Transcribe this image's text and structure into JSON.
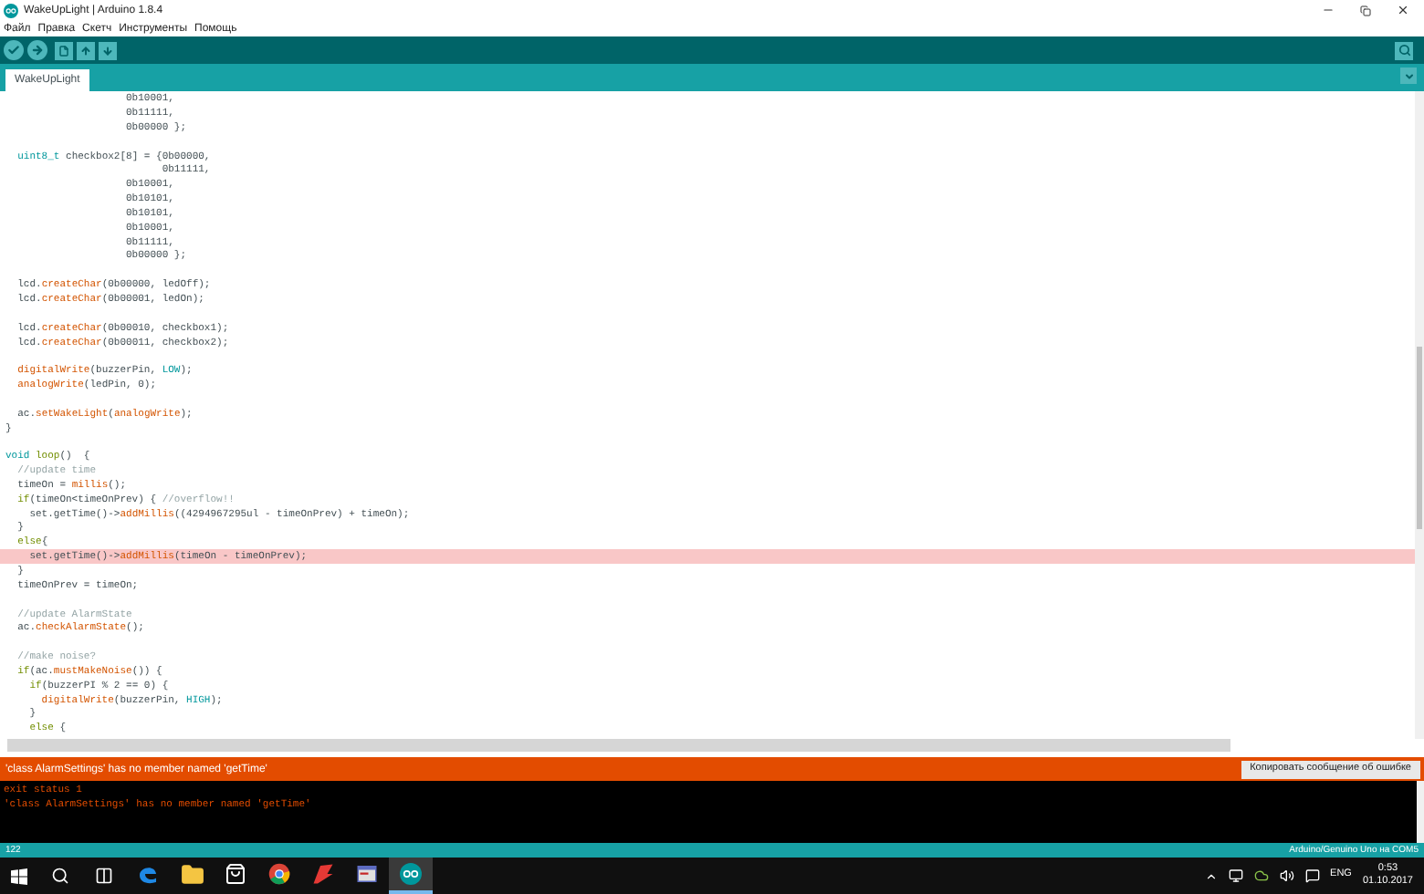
{
  "window": {
    "title": "WakeUpLight | Arduino 1.8.4"
  },
  "menu": [
    "Файл",
    "Правка",
    "Скетч",
    "Инструменты",
    "Помощь"
  ],
  "tabs": [
    {
      "label": "WakeUpLight",
      "selected": true
    }
  ],
  "code_lines": [
    {
      "highlighted": false,
      "segments": [
        {
          "kind": "plain",
          "text": "                    0b10001,"
        }
      ]
    },
    {
      "highlighted": false,
      "segments": [
        {
          "kind": "plain",
          "text": "                    0b11111,"
        }
      ]
    },
    {
      "highlighted": false,
      "segments": [
        {
          "kind": "plain",
          "text": "                    0b00000 };"
        }
      ]
    },
    {
      "highlighted": false
    },
    {
      "highlighted": false,
      "segments": [
        {
          "kind": "type",
          "text": "  uint8_t"
        },
        {
          "kind": "plain",
          "text": " checkbox2[8] = {0b00000,"
        }
      ]
    },
    {
      "highlighted": false,
      "segments": [
        {
          "kind": "plain",
          "text": "                          0b11111,"
        }
      ]
    },
    {
      "highlighted": false,
      "segments": [
        {
          "kind": "plain",
          "text": "                    0b10001,"
        }
      ]
    },
    {
      "highlighted": false,
      "segments": [
        {
          "kind": "plain",
          "text": "                    0b10101,"
        }
      ]
    },
    {
      "highlighted": false,
      "segments": [
        {
          "kind": "plain",
          "text": "                    0b10101,"
        }
      ]
    },
    {
      "highlighted": false,
      "segments": [
        {
          "kind": "plain",
          "text": "                    0b10001,"
        }
      ]
    },
    {
      "highlighted": false,
      "segments": [
        {
          "kind": "plain",
          "text": "                    0b11111,"
        }
      ]
    },
    {
      "highlighted": false,
      "segments": [
        {
          "kind": "plain",
          "text": "                    0b00000 };"
        }
      ]
    },
    {
      "highlighted": false
    },
    {
      "highlighted": false,
      "segments": [
        {
          "kind": "plain",
          "text": "  lcd."
        },
        {
          "kind": "function",
          "text": "createChar"
        },
        {
          "kind": "plain",
          "text": "(0b00000, ledOff);"
        }
      ]
    },
    {
      "highlighted": false,
      "segments": [
        {
          "kind": "plain",
          "text": "  lcd."
        },
        {
          "kind": "function",
          "text": "createChar"
        },
        {
          "kind": "plain",
          "text": "(0b00001, ledOn);"
        }
      ]
    },
    {
      "highlighted": false
    },
    {
      "highlighted": false,
      "segments": [
        {
          "kind": "plain",
          "text": "  lcd."
        },
        {
          "kind": "function",
          "text": "createChar"
        },
        {
          "kind": "plain",
          "text": "(0b00010, checkbox1);"
        }
      ]
    },
    {
      "highlighted": false,
      "segments": [
        {
          "kind": "plain",
          "text": "  lcd."
        },
        {
          "kind": "function",
          "text": "createChar"
        },
        {
          "kind": "plain",
          "text": "(0b00011, checkbox2);"
        }
      ]
    },
    {
      "highlighted": false
    },
    {
      "highlighted": false,
      "segments": [
        {
          "kind": "function",
          "text": "  digitalWrite"
        },
        {
          "kind": "plain",
          "text": "(buzzerPin, "
        },
        {
          "kind": "constant",
          "text": "LOW"
        },
        {
          "kind": "plain",
          "text": ");"
        }
      ]
    },
    {
      "highlighted": false,
      "segments": [
        {
          "kind": "function",
          "text": "  analogWrite"
        },
        {
          "kind": "plain",
          "text": "(ledPin, 0);"
        }
      ]
    },
    {
      "highlighted": false
    },
    {
      "highlighted": false,
      "segments": [
        {
          "kind": "plain",
          "text": "  ac."
        },
        {
          "kind": "function",
          "text": "setWakeLight"
        },
        {
          "kind": "plain",
          "text": "("
        },
        {
          "kind": "function",
          "text": "analogWrite"
        },
        {
          "kind": "plain",
          "text": ");"
        }
      ]
    },
    {
      "highlighted": false,
      "segments": [
        {
          "kind": "plain",
          "text": "}"
        }
      ]
    },
    {
      "highlighted": false
    },
    {
      "highlighted": false,
      "segments": [
        {
          "kind": "type",
          "text": "void"
        },
        {
          "kind": "keyword",
          "text": " loop"
        },
        {
          "kind": "plain",
          "text": "()  {"
        }
      ]
    },
    {
      "highlighted": false,
      "segments": [
        {
          "kind": "comment",
          "text": "  //update time"
        }
      ]
    },
    {
      "highlighted": false,
      "segments": [
        {
          "kind": "plain",
          "text": "  timeOn = "
        },
        {
          "kind": "function",
          "text": "millis"
        },
        {
          "kind": "plain",
          "text": "();"
        }
      ]
    },
    {
      "highlighted": false,
      "segments": [
        {
          "kind": "keyword",
          "text": "  if"
        },
        {
          "kind": "plain",
          "text": "(timeOn<timeOnPrev) { "
        },
        {
          "kind": "comment",
          "text": "//overflow!!"
        }
      ]
    },
    {
      "highlighted": false,
      "segments": [
        {
          "kind": "plain",
          "text": "    set.getTime()->"
        },
        {
          "kind": "function",
          "text": "addMillis"
        },
        {
          "kind": "plain",
          "text": "((4294967295ul - timeOnPrev) + timeOn);"
        }
      ]
    },
    {
      "highlighted": false,
      "segments": [
        {
          "kind": "plain",
          "text": "  }"
        }
      ]
    },
    {
      "highlighted": false,
      "segments": [
        {
          "kind": "keyword",
          "text": "  else"
        },
        {
          "kind": "plain",
          "text": "{"
        }
      ]
    },
    {
      "highlighted": true,
      "segments": [
        {
          "kind": "plain",
          "text": "    set.getTime()->"
        },
        {
          "kind": "function",
          "text": "addMillis"
        },
        {
          "kind": "plain",
          "text": "(timeOn - timeOnPrev);"
        }
      ]
    },
    {
      "highlighted": false,
      "segments": [
        {
          "kind": "plain",
          "text": "  }"
        }
      ]
    },
    {
      "highlighted": false,
      "segments": [
        {
          "kind": "plain",
          "text": "  timeOnPrev = timeOn;"
        }
      ]
    },
    {
      "highlighted": false
    },
    {
      "highlighted": false,
      "segments": [
        {
          "kind": "comment",
          "text": "  //update AlarmState"
        }
      ]
    },
    {
      "highlighted": false,
      "segments": [
        {
          "kind": "plain",
          "text": "  ac."
        },
        {
          "kind": "function",
          "text": "checkAlarmState"
        },
        {
          "kind": "plain",
          "text": "();"
        }
      ]
    },
    {
      "highlighted": false
    },
    {
      "highlighted": false,
      "segments": [
        {
          "kind": "comment",
          "text": "  //make noise?"
        }
      ]
    },
    {
      "highlighted": false,
      "segments": [
        {
          "kind": "keyword",
          "text": "  if"
        },
        {
          "kind": "plain",
          "text": "(ac."
        },
        {
          "kind": "function",
          "text": "mustMakeNoise"
        },
        {
          "kind": "plain",
          "text": "()) {"
        }
      ]
    },
    {
      "highlighted": false,
      "segments": [
        {
          "kind": "keyword",
          "text": "    if"
        },
        {
          "kind": "plain",
          "text": "(buzzerPI % 2 == 0) {"
        }
      ]
    },
    {
      "highlighted": false,
      "segments": [
        {
          "kind": "function",
          "text": "      digitalWrite"
        },
        {
          "kind": "plain",
          "text": "(buzzerPin, "
        },
        {
          "kind": "constant",
          "text": "HIGH"
        },
        {
          "kind": "plain",
          "text": ");"
        }
      ]
    },
    {
      "highlighted": false,
      "segments": [
        {
          "kind": "plain",
          "text": "    }"
        }
      ]
    },
    {
      "highlighted": false,
      "segments": [
        {
          "kind": "keyword",
          "text": "    else"
        },
        {
          "kind": "plain",
          "text": " {"
        }
      ]
    }
  ],
  "error_bar": {
    "message": "'class AlarmSettings' has no member named 'getTime'",
    "button": "Копировать сообщение об ошибке"
  },
  "console": [
    "exit status 1",
    "'class AlarmSettings' has no member named 'getTime'"
  ],
  "status_bar": {
    "line": "122",
    "board": "Arduino/Genuino Uno на COM5"
  },
  "taskbar": {
    "apps": [
      {
        "kind": "edge",
        "selected": false
      },
      {
        "kind": "folder",
        "selected": false
      },
      {
        "kind": "store",
        "selected": false
      },
      {
        "kind": "chrome",
        "selected": false
      },
      {
        "kind": "red",
        "selected": false
      },
      {
        "kind": "window",
        "selected": false
      },
      {
        "kind": "arduino",
        "selected": true
      }
    ],
    "language": "ENG",
    "time": "0:53",
    "date": "01.10.2017"
  }
}
